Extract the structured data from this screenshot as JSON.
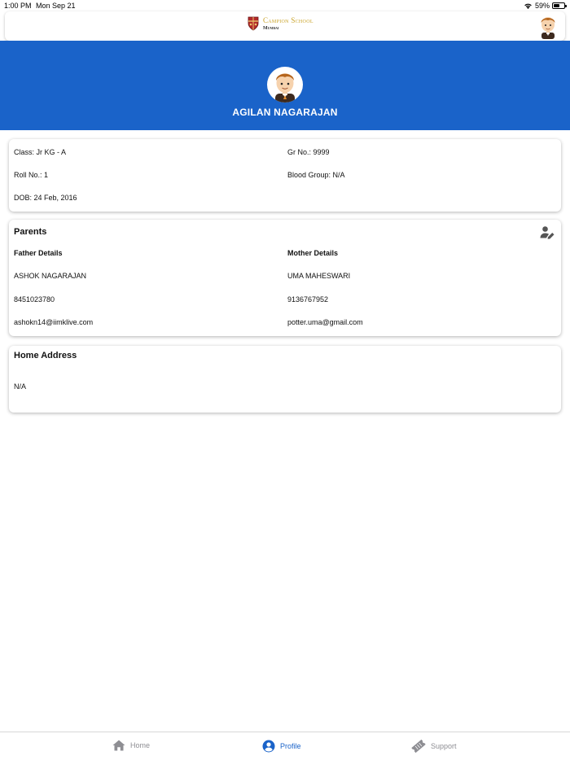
{
  "status_bar": {
    "time": "1:00 PM",
    "date": "Mon Sep 21",
    "battery": "59%",
    "battery_level": 0.59
  },
  "header": {
    "school_name": "Campion School",
    "school_city": "Mumbai"
  },
  "profile": {
    "student_name": "AGILAN NAGARAJAN"
  },
  "student_info": {
    "class": "Class: Jr KG - A",
    "gr_no": "Gr No.: 9999",
    "roll_no": "Roll No.: 1",
    "blood_group": "Blood Group: N/A",
    "dob": "DOB: 24 Feb, 2016"
  },
  "parents": {
    "title": "Parents",
    "father": {
      "label": "Father Details",
      "name": "ASHOK NAGARAJAN",
      "phone": "8451023780",
      "email": "ashokn14@iimklive.com"
    },
    "mother": {
      "label": "Mother Details",
      "name": "UMA MAHESWARI",
      "phone": "9136767952",
      "email": "potter.uma@gmail.com"
    }
  },
  "address": {
    "title": "Home Address",
    "value": "N/A"
  },
  "tabs": [
    {
      "label": "Home",
      "icon": "home-icon"
    },
    {
      "label": "Profile",
      "icon": "profile-icon"
    },
    {
      "label": "Support",
      "icon": "ticket-icon"
    }
  ],
  "colors": {
    "primary": "#1a63c9",
    "inactive": "#8e8e93",
    "gold": "#c9a227"
  }
}
